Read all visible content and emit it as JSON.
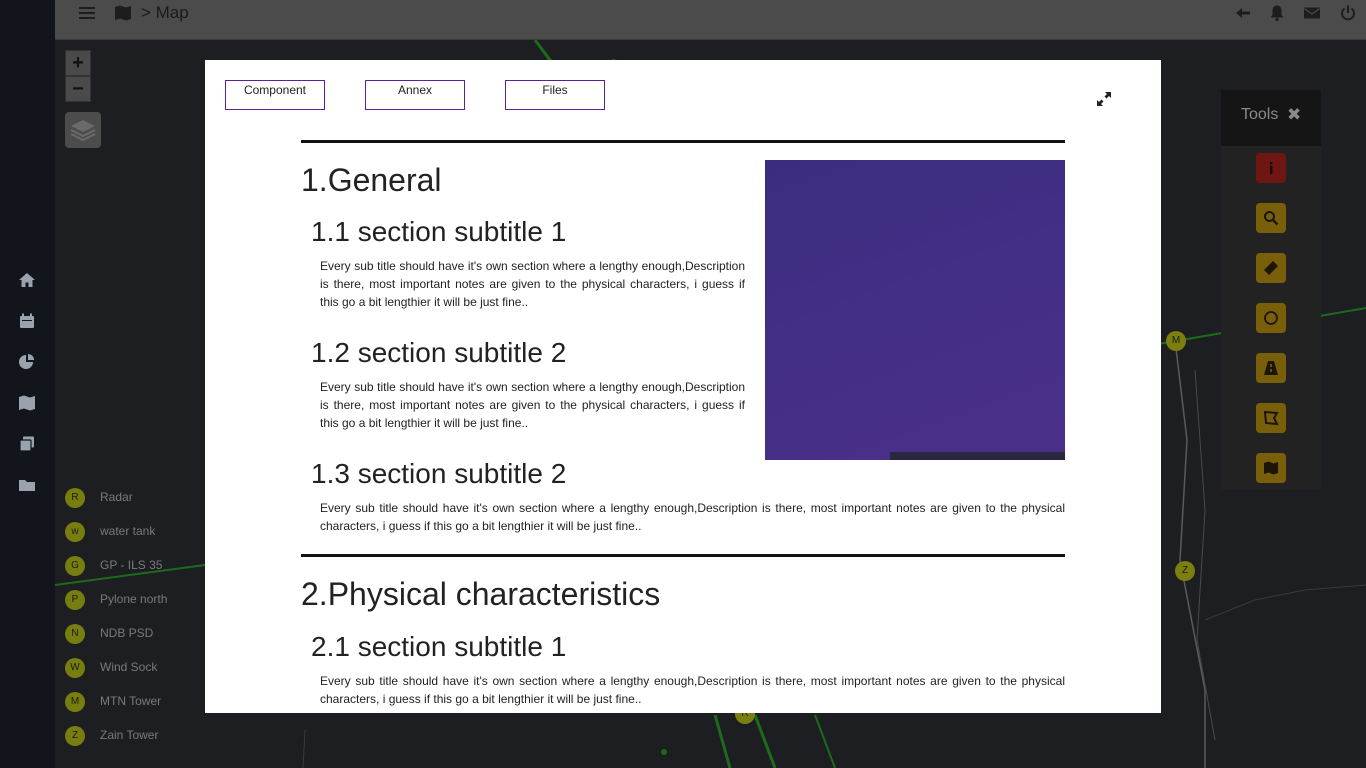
{
  "topbar": {
    "breadcrumb": "> Map"
  },
  "legend": [
    {
      "marker": "R",
      "label": "Radar"
    },
    {
      "marker": "w",
      "label": "water tank"
    },
    {
      "marker": "G",
      "label": "GP - ILS 35"
    },
    {
      "marker": "P",
      "label": "Pylone north"
    },
    {
      "marker": "N",
      "label": "NDB PSD"
    },
    {
      "marker": "W",
      "label": "Wind Sock"
    },
    {
      "marker": "M",
      "label": "MTN Tower"
    },
    {
      "marker": "Z",
      "label": "Zain Tower"
    }
  ],
  "map_markers": {
    "m": "M",
    "z": "Z",
    "r": "R"
  },
  "zoom": {
    "in": "+",
    "out": "−"
  },
  "tools": {
    "title": "Tools",
    "close": "✖",
    "buttons": [
      "info-icon",
      "search-icon",
      "ruler-icon",
      "circle-icon",
      "road-icon",
      "polygon-icon",
      "map-icon"
    ]
  },
  "modal": {
    "tabs": [
      "Component",
      "Annex",
      "Files"
    ],
    "section1": {
      "title": "1.General",
      "sub1": {
        "title": "1.1 section subtitle 1",
        "text": "Every sub title should have it's own section where a lengthy enough,Description is there, most important notes are given to the physical characters, i guess if this go a bit lengthier it will be just fine.."
      },
      "sub2": {
        "title": "1.2 section subtitle 2",
        "text": "Every sub title should have it's own section where a lengthy enough,Description is there, most important notes are given to the physical characters, i guess if this go a bit lengthier it will be just fine.."
      },
      "sub3": {
        "title": "1.3 section subtitle 2",
        "text": "Every sub title should have it's own section where a lengthy enough,Description is there, most important notes are given to the physical characters, i guess if this go a bit lengthier it will be just fine.."
      }
    },
    "section2": {
      "title": "2.Physical characteristics",
      "sub1": {
        "title": "2.1 section subtitle 1",
        "text": "Every sub title should have it's own section where a lengthy enough,Description is there, most important notes are given to the physical characters, i guess if this go a bit lengthier it will be just fine.."
      }
    }
  }
}
